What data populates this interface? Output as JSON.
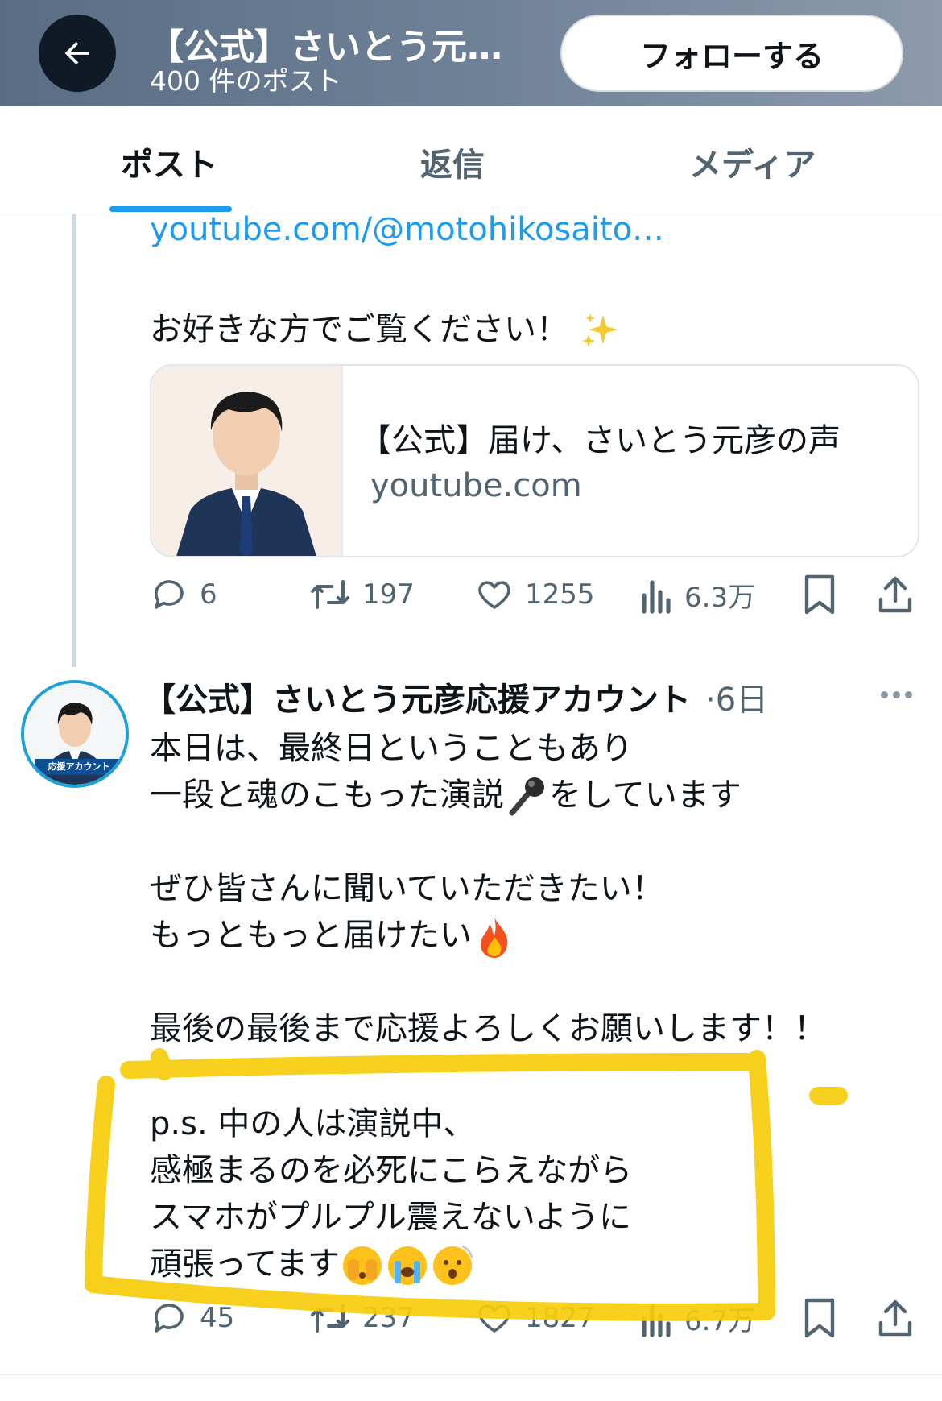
{
  "header": {
    "title": "【公式】さいとう元…",
    "post_count": "400 件のポスト",
    "follow_label": "フォローする"
  },
  "tabs": [
    {
      "label": "ポスト",
      "active": true
    },
    {
      "label": "返信",
      "active": false
    },
    {
      "label": "メディア",
      "active": false
    }
  ],
  "post1": {
    "link": "youtube.com/@motohikosaito…",
    "text": "お好きな方でご覧ください！",
    "card": {
      "title": "【公式】届け、さいとう元彦の声",
      "domain": "youtube.com"
    },
    "stats": {
      "replies": "6",
      "reposts": "197",
      "likes": "1255",
      "views": "6.3万"
    }
  },
  "post2": {
    "author": "【公式】さいとう元彦応援アカウント",
    "time": "·6日",
    "avatar_badge": "応援アカウント",
    "lines": {
      "l1": "本日は、最終日ということもあり",
      "l2a": "一段と魂のこもった演説",
      "l2b": "をしています",
      "l3": "ぜひ皆さんに聞いていただきたい！",
      "l4": "もっともっと届けたい",
      "l5": "最後の最後まで応援よろしくお願いします！！",
      "l6": "p.s. 中の人は演説中、",
      "l7": "感極まるのを必死にこらえながら",
      "l8": "スマホがプルプル震えないように",
      "l9": "頑張ってます"
    },
    "stats": {
      "replies": "45",
      "reposts": "237",
      "likes": "1827",
      "views": "6.7万"
    }
  },
  "colors": {
    "accent": "#1d9bf0",
    "highlight": "#f6cd0a",
    "header_bg": "#6f8197"
  },
  "icons": [
    "back-arrow-icon",
    "sparkles-emoji",
    "microphone-emoji",
    "fire-emoji",
    "face-peeking-emoji",
    "loudly-crying-emoji",
    "astonished-face-emoji",
    "reply-icon",
    "repost-icon",
    "like-icon",
    "views-icon",
    "bookmark-icon",
    "share-icon",
    "more-icon"
  ]
}
